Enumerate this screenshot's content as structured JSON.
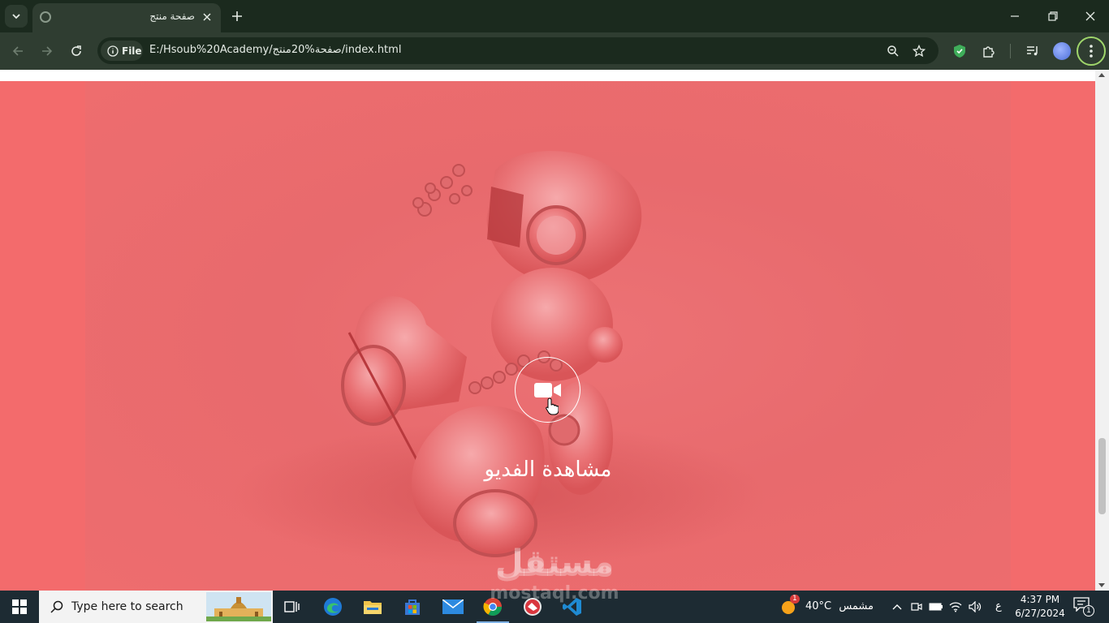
{
  "browser": {
    "tab_title": "صفحة منتج",
    "site_chip_label": "File",
    "url": "E:/Hsoub%20Academy/صفحة%20منتج/index.html"
  },
  "page": {
    "video_label": "مشاهدة الفديو",
    "watermark_ar": "مستقل",
    "watermark_en": "mostaql.com",
    "colors": {
      "hero_overlay": "#f36b6c",
      "accent_white": "#ffffff"
    }
  },
  "taskbar": {
    "search_placeholder": "Type here to search",
    "weather_temp": "40°C",
    "weather_desc": "مشمس",
    "weather_badge": "1",
    "lang": "ع",
    "time": "4:37 PM",
    "date": "6/27/2024",
    "notification_count": "1",
    "apps": [
      "task-view",
      "edge",
      "file-explorer",
      "microsoft-store",
      "mail",
      "chrome",
      "app-red",
      "vscode"
    ]
  }
}
